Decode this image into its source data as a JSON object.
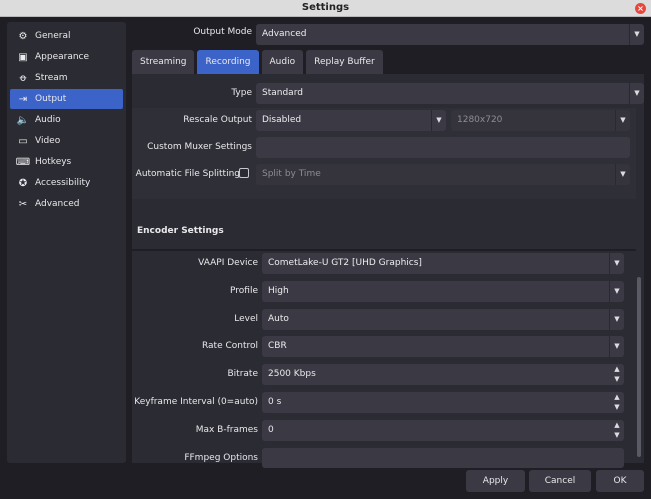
{
  "window": {
    "title": "Settings",
    "close_glyph": "×"
  },
  "sidebar": {
    "items": [
      {
        "label": "General",
        "icon": "gear-icon",
        "glyph": "⚙"
      },
      {
        "label": "Appearance",
        "icon": "appearance-icon",
        "glyph": "▣"
      },
      {
        "label": "Stream",
        "icon": "antenna-icon",
        "glyph": "ꝋ"
      },
      {
        "label": "Output",
        "icon": "output-icon",
        "glyph": "⇥"
      },
      {
        "label": "Audio",
        "icon": "speaker-icon",
        "glyph": "🔈"
      },
      {
        "label": "Video",
        "icon": "monitor-icon",
        "glyph": "▭"
      },
      {
        "label": "Hotkeys",
        "icon": "keyboard-icon",
        "glyph": "⌨"
      },
      {
        "label": "Accessibility",
        "icon": "accessibility-icon",
        "glyph": "✪"
      },
      {
        "label": "Advanced",
        "icon": "tools-icon",
        "glyph": "✂"
      }
    ],
    "active_index": 3
  },
  "output_mode": {
    "label": "Output Mode",
    "value": "Advanced"
  },
  "tabs": [
    "Streaming",
    "Recording",
    "Audio",
    "Replay Buffer"
  ],
  "active_tab": "Recording",
  "recording": {
    "type_label": "Type",
    "type_value": "Standard",
    "rescale_label": "Rescale Output",
    "rescale_value": "Disabled",
    "rescale_resolution": "1280x720",
    "muxer_label": "Custom Muxer Settings",
    "muxer_value": "",
    "split_label": "Automatic File Splitting",
    "split_checked": false,
    "split_value": "Split by Time"
  },
  "encoder": {
    "heading": "Encoder Settings",
    "vaapi_label": "VAAPI Device",
    "vaapi_value": "CometLake-U GT2 [UHD Graphics]",
    "profile_label": "Profile",
    "profile_value": "High",
    "level_label": "Level",
    "level_value": "Auto",
    "rate_label": "Rate Control",
    "rate_value": "CBR",
    "bitrate_label": "Bitrate",
    "bitrate_value": "2500 Kbps",
    "keyframe_label": "Keyframe Interval (0=auto)",
    "keyframe_value": "0 s",
    "bframes_label": "Max B-frames",
    "bframes_value": "0",
    "ffmpeg_label": "FFmpeg Options",
    "ffmpeg_value": ""
  },
  "footer": {
    "apply": "Apply",
    "cancel": "Cancel",
    "ok": "OK"
  },
  "colors": {
    "accent": "#3c64c8",
    "background": "#1f1e25",
    "panel": "#2b2b33",
    "input": "#3b3a44"
  }
}
